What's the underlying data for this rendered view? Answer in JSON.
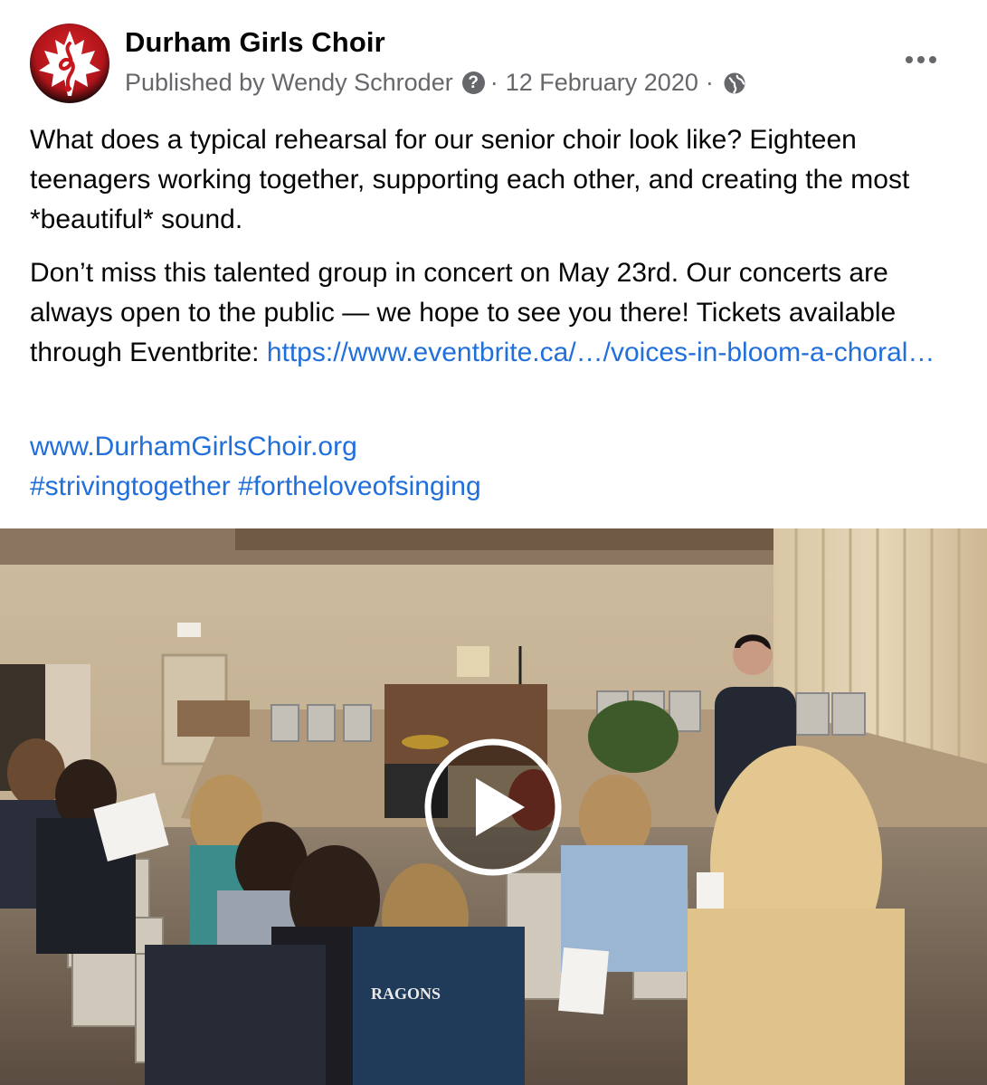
{
  "post": {
    "page_name": "Durham Girls Choir",
    "meta": {
      "published_by": "Published by Wendy Schroder",
      "help_icon_glyph": "?",
      "separator": "·",
      "date": "12 February 2020",
      "audience_icon": "globe-icon"
    },
    "more_icon": "more-horizontal-icon",
    "paragraphs": {
      "p1": "What does a typical rehearsal for our senior choir look like? Eighteen teenagers working together, supporting each other, and creating the most *beautiful* sound.",
      "p2_text": "Don’t miss this talented group in concert on May 23rd. Our concerts are always open to the public — we hope to see you there! Tickets available through Eventbrite: ",
      "p2_link": "https://www.eventbrite.ca/…/voices-in-bloom-a-choral…",
      "website_link": "www.DurhamGirlsChoir.org",
      "hashtags": [
        "#strivingtogether",
        "#fortheloveofsinging"
      ]
    },
    "video": {
      "play_icon": "play-icon",
      "jacket_text": "RAGONS"
    },
    "colors": {
      "link": "#216fdb",
      "secondary_text": "#65676b",
      "brand_red": "#c8161d"
    }
  }
}
